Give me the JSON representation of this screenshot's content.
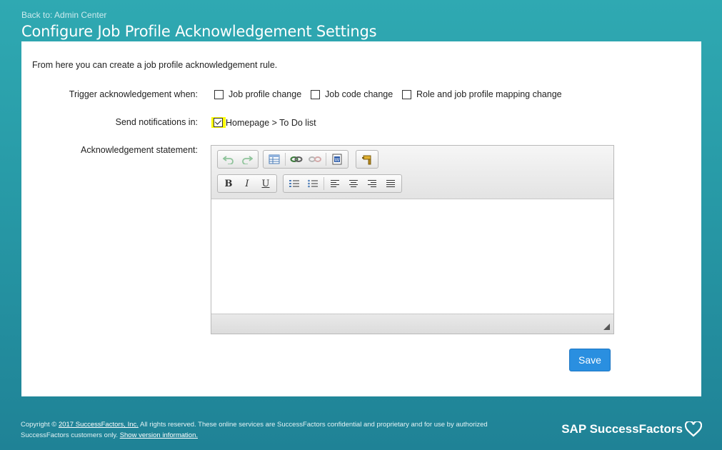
{
  "header": {
    "back_link": "Back to: Admin Center",
    "title": "Configure Job Profile Acknowledgement Settings"
  },
  "form": {
    "intro": "From here you can create a job profile acknowledgement rule.",
    "trigger": {
      "label": "Trigger acknowledgement when:",
      "options": [
        {
          "label": "Job profile change",
          "checked": false
        },
        {
          "label": "Job code change",
          "checked": false
        },
        {
          "label": "Role and job profile mapping change",
          "checked": false
        }
      ]
    },
    "notifications": {
      "label": "Send notifications in:",
      "option": {
        "label": "Homepage > To Do list",
        "checked": true
      }
    },
    "statement": {
      "label": "Acknowledgement statement:",
      "value": "",
      "toolbar": {
        "bold": "B",
        "italic": "I",
        "underline": "U"
      }
    },
    "save_label": "Save"
  },
  "footer": {
    "copyright_prefix": "Copyright ©",
    "company_link": "2017 SuccessFactors, Inc.",
    "copyright_text": "All rights reserved. These online services are SuccessFactors confidential and proprietary and for use by authorized SuccessFactors customers only.",
    "version_link": "Show version information.",
    "brand": "SAP SuccessFactors"
  },
  "colors": {
    "background": "#2799a6",
    "save_button": "#2a8fe0",
    "highlight": "#ffff00"
  }
}
